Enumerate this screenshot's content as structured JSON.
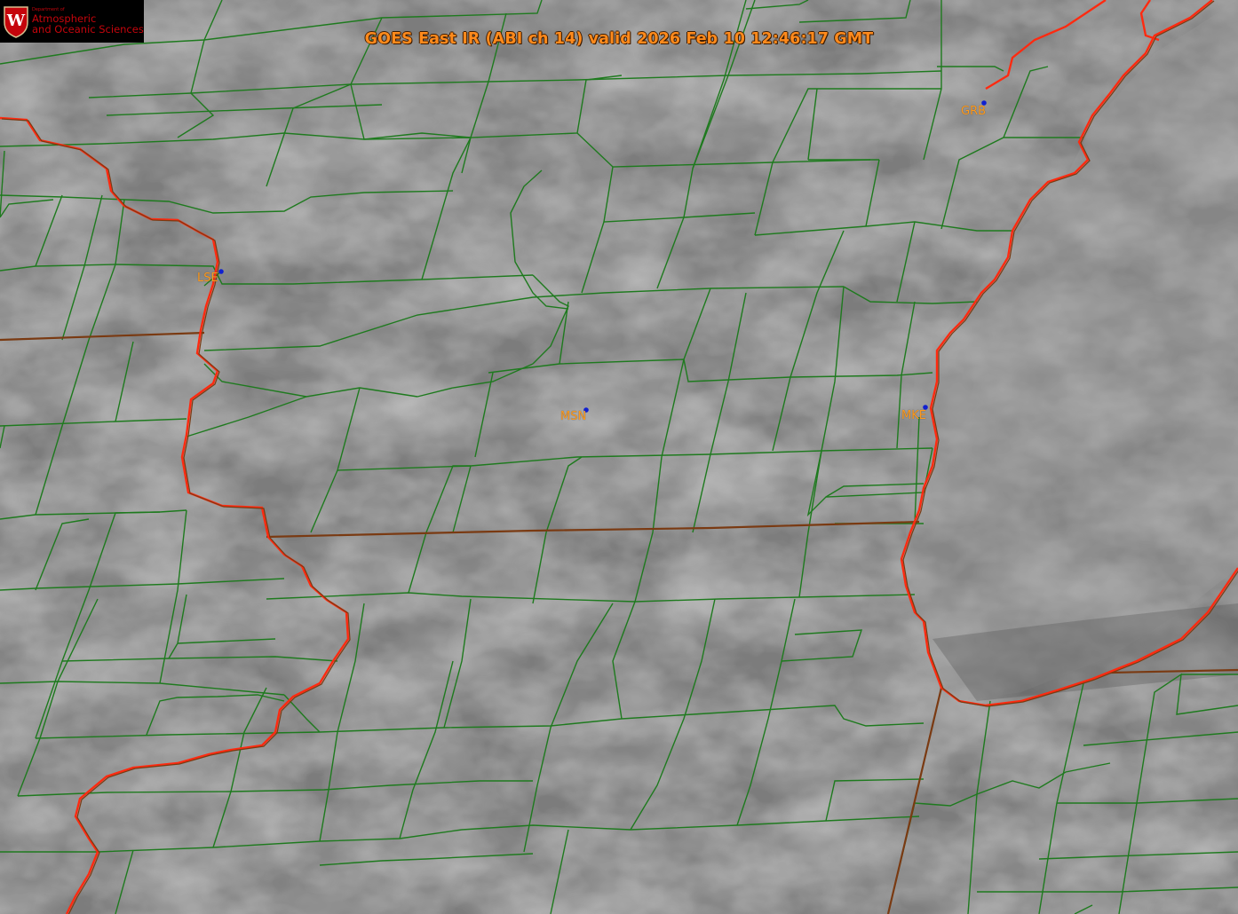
{
  "title": "GOES East IR (ABI ch 14) valid 2026 Feb 10 12:46:17 GMT",
  "logo": {
    "line0": "Department of",
    "line1": "Atmospheric",
    "line2": "and Oceanic Sciences",
    "crest_letter": "W"
  },
  "stations": [
    {
      "id": "LSE",
      "label": "LSE"
    },
    {
      "id": "MSN",
      "label": "MSN"
    },
    {
      "id": "MKE",
      "label": "MKE"
    },
    {
      "id": "GRB",
      "label": "GRB"
    }
  ],
  "colors": {
    "county_lines": "#1e7a1e",
    "state_lines": "#7a3a12",
    "rivers_coast": "#ff2a10",
    "title_text": "#ff8a1c",
    "station_dot": "#1020d0"
  }
}
